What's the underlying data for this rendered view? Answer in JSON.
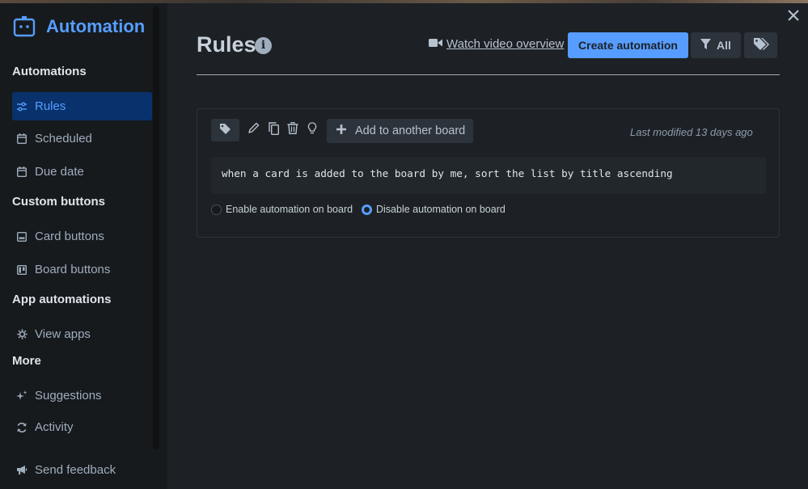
{
  "app": {
    "title": "Automation"
  },
  "sidebar": {
    "sections": [
      {
        "title": "Automations"
      },
      {
        "title": "Custom buttons"
      },
      {
        "title": "App automations"
      },
      {
        "title": "More"
      }
    ],
    "items": [
      {
        "label": "Rules",
        "icon": "sliders-icon",
        "active": true
      },
      {
        "label": "Scheduled",
        "icon": "calendar-icon"
      },
      {
        "label": "Due date",
        "icon": "calendar-icon"
      },
      {
        "label": "Card buttons",
        "icon": "card-icon"
      },
      {
        "label": "Board buttons",
        "icon": "board-icon"
      },
      {
        "label": "View apps",
        "icon": "gear-icon"
      },
      {
        "label": "Suggestions",
        "icon": "sparkles-icon"
      },
      {
        "label": "Activity",
        "icon": "refresh-icon"
      },
      {
        "label": "Send feedback",
        "icon": "megaphone-icon"
      }
    ]
  },
  "header": {
    "title": "Rules",
    "video_link": "Watch video overview",
    "create_button": "Create automation",
    "filter_button": "All"
  },
  "rule": {
    "add_board_label": "Add to another board",
    "last_modified": "Last modified 13 days ago",
    "text": "when a card is added to the board by me, sort the list by title ascending",
    "enable_label": "Enable automation on board",
    "disable_label": "Disable automation on board",
    "state": "disabled"
  },
  "colors": {
    "accent": "#579dff",
    "background": "#1d2125",
    "sidebar": "#161a1d",
    "active_item_bg": "#09326c"
  }
}
